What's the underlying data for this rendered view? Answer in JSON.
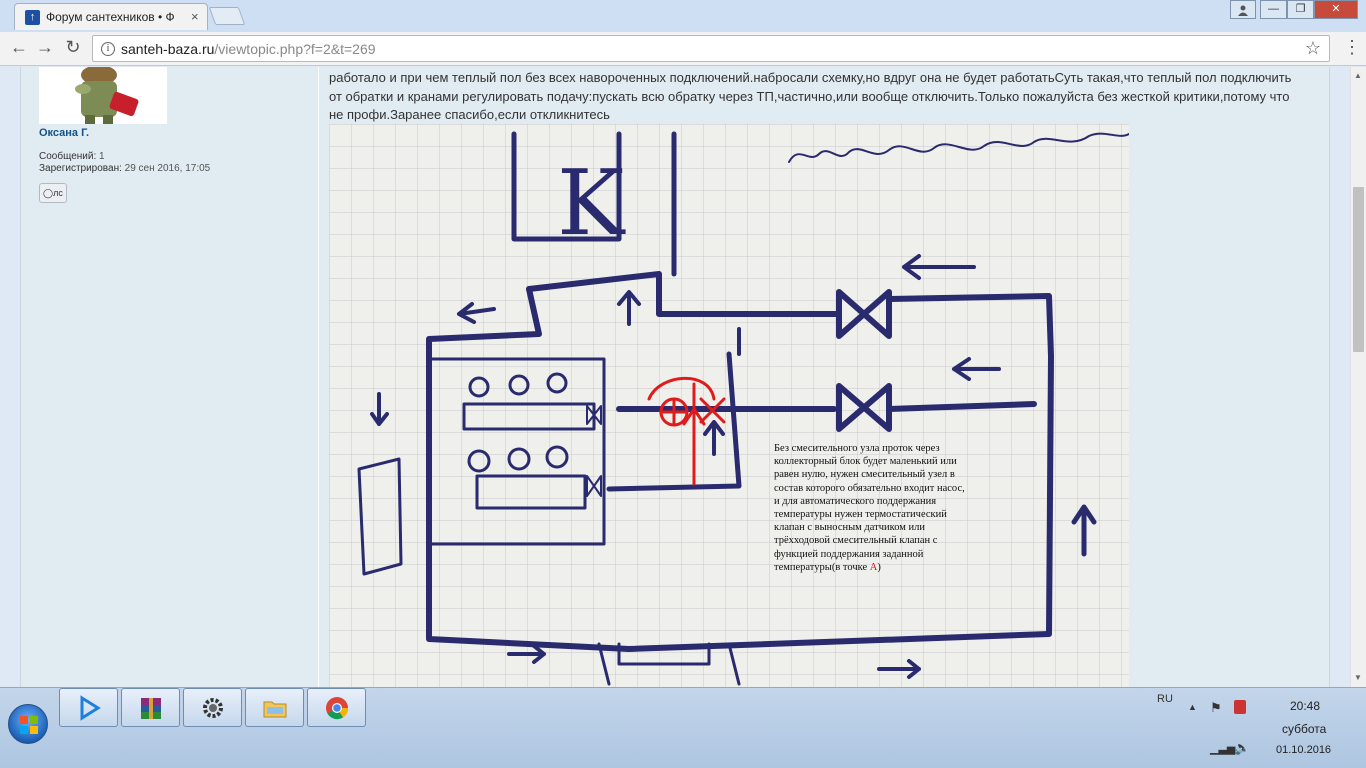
{
  "browser": {
    "tab_title": "Форум сантехников • Ф",
    "tab_close": "×",
    "url_host": "santeh-baza.ru",
    "url_path": "/viewtopic.php?f=2&t=269",
    "window_min": "—",
    "window_max": "❐",
    "window_close": "✕"
  },
  "profile": {
    "username": "Оксана Г.",
    "posts_label": "Сообщений:",
    "posts_value": "1",
    "registered_label": "Зарегистрирован:",
    "registered_value": "29 сен 2016, 17:05",
    "pm_label": "лс"
  },
  "post": {
    "lines": [
      "работало и при чем теплый пол без всех навороченных подключений.набросали схемку,но вдруг она не будет работатьСуть такая,что теплый пол подключить",
      "от обратки и кранами регулировать подачу:пускать всю обратку через ТП,частично,или вообще отключить.Только пожалуйста без жесткой критики,потому что",
      "не профи.Заранее спасибо,если откликнитесь"
    ]
  },
  "sketch": {
    "k_label": "K",
    "handwriting": "помпопроходн",
    "note_lines": [
      "Без смесительного узла проток через",
      "коллекторный блок будет маленький или",
      "равен нулю, нужен смесительный узел в",
      "состав которого обязательно входит насос,",
      "и для автоматического поддержания",
      "температуры нужен термостатический",
      "клапан с выносным датчиком или",
      "трёхходовой смесительный клапан с",
      "функцией поддержания заданной"
    ],
    "note_last_prefix": "температуры(в точке ",
    "note_point": "А",
    "note_last_suffix": ")",
    "colors": {
      "ink": "#2a2a6e",
      "red": "#e01b1b",
      "grid": "#c9c9cf"
    }
  },
  "taskbar": {
    "lang": "RU",
    "time": "20:48",
    "day": "суббота",
    "date": "01.10.2016",
    "apps": [
      "media-player-icon",
      "winrar-icon",
      "settings-icon",
      "explorer-icon",
      "chrome-icon"
    ]
  }
}
